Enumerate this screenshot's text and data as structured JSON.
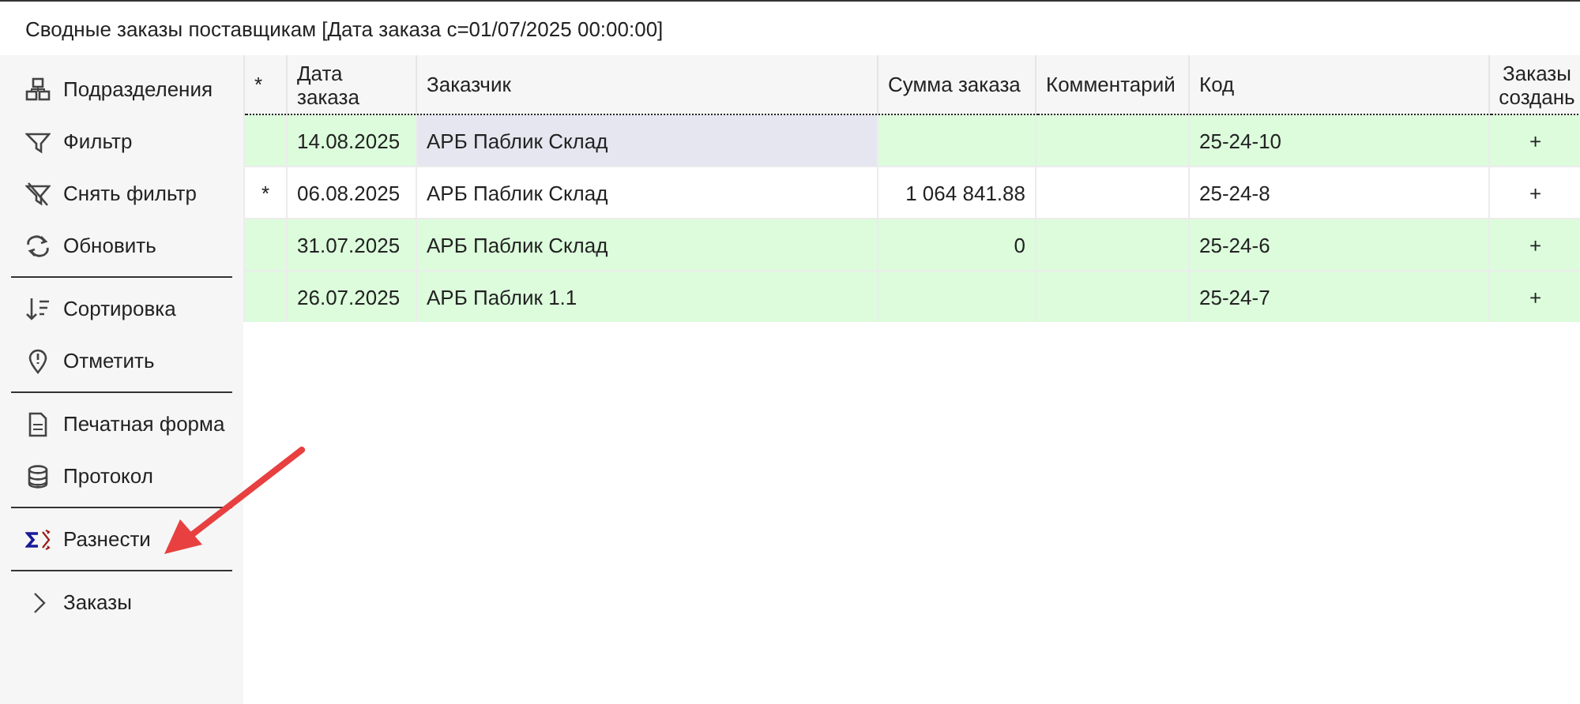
{
  "window": {
    "title": "Сводные заказы поставщикам [Дата заказа с=01/07/2025 00:00:00]"
  },
  "sidebar": {
    "groups": [
      [
        {
          "label": "Подразделения"
        },
        {
          "label": "Фильтр"
        },
        {
          "label": "Снять фильтр"
        },
        {
          "label": "Обновить"
        }
      ],
      [
        {
          "label": "Сортировка"
        },
        {
          "label": "Отметить"
        }
      ],
      [
        {
          "label": "Печатная форма"
        },
        {
          "label": "Протокол"
        }
      ],
      [
        {
          "label": "Разнести"
        }
      ],
      [
        {
          "label": "Заказы",
          "expanded": false
        }
      ]
    ]
  },
  "table": {
    "columns": [
      {
        "label": "*"
      },
      {
        "label": "Дата заказа"
      },
      {
        "label": "Заказчик"
      },
      {
        "label": "Сумма заказа"
      },
      {
        "label": "Комментарий"
      },
      {
        "label": "Код"
      },
      {
        "label": "Заказы создань"
      }
    ],
    "rows": [
      {
        "selected": true,
        "highlighted": true,
        "cells": [
          "",
          "14.08.2025",
          "АРБ Паблик Склад",
          "",
          "",
          "25-24-10",
          "+"
        ]
      },
      {
        "selected": false,
        "highlighted": false,
        "cells": [
          "*",
          "06.08.2025",
          "АРБ Паблик Склад",
          "1 064 841.88",
          "",
          "25-24-8",
          "+"
        ]
      },
      {
        "selected": false,
        "highlighted": true,
        "cells": [
          "",
          "31.07.2025",
          "АРБ Паблик Склад",
          "0",
          "",
          "25-24-6",
          "+"
        ]
      },
      {
        "selected": false,
        "highlighted": true,
        "cells": [
          "",
          "26.07.2025",
          "АРБ Паблик 1.1",
          "",
          "",
          "25-24-7",
          "+"
        ]
      }
    ]
  }
}
